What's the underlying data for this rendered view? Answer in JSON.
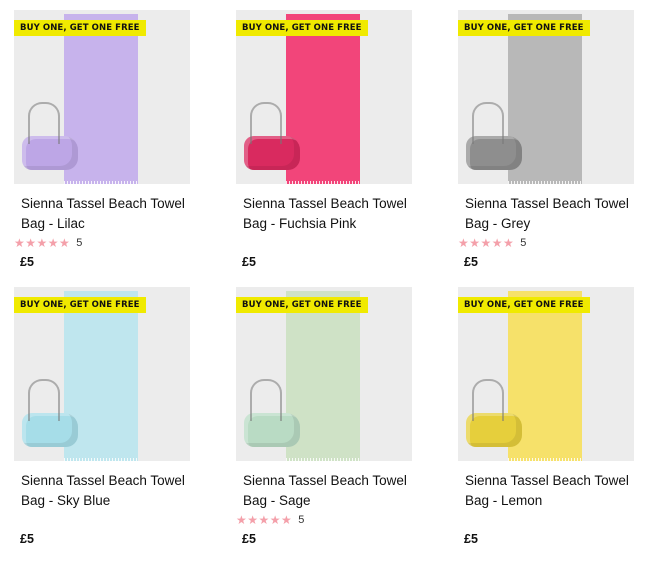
{
  "products": [
    {
      "badge": "BUY ONE, GET ONE FREE",
      "title": "Sienna Tassel Beach Towel Bag - Lilac",
      "rating": 5,
      "stars": "★★★★★",
      "rating_count": "5",
      "price": "£5",
      "color": "#c7b3ec"
    },
    {
      "badge": "BUY ONE, GET ONE FREE",
      "title": "Sienna Tassel Beach Towel Bag - Fuchsia Pink",
      "stars": "",
      "rating_count": "",
      "price": "£5",
      "color": "#f2457a"
    },
    {
      "badge": "BUY ONE, GET ONE FREE",
      "title": "Sienna Tassel Beach Towel Bag - Grey",
      "rating": 5,
      "stars": "★★★★★",
      "rating_count": "5",
      "price": "£5",
      "color": "#b8b8b8"
    },
    {
      "badge": "BUY ONE, GET ONE FREE",
      "title": "Sienna Tassel Beach Towel Bag - Sky Blue",
      "stars": "",
      "rating_count": "",
      "price": "£5",
      "color": "#bfe6ee"
    },
    {
      "badge": "BUY ONE, GET ONE FREE",
      "title": "Sienna Tassel Beach Towel Bag - Sage",
      "rating": 5,
      "stars": "★★★★★",
      "rating_count": "5",
      "price": "£5",
      "color": "#cfe2c6"
    },
    {
      "badge": "BUY ONE, GET ONE FREE",
      "title": "Sienna Tassel Beach Towel Bag - Lemon",
      "stars": "",
      "rating_count": "",
      "price": "£5",
      "color": "#f6e16a"
    }
  ],
  "star_color": "#f4a0aa",
  "badge_color": "#f0ea00"
}
